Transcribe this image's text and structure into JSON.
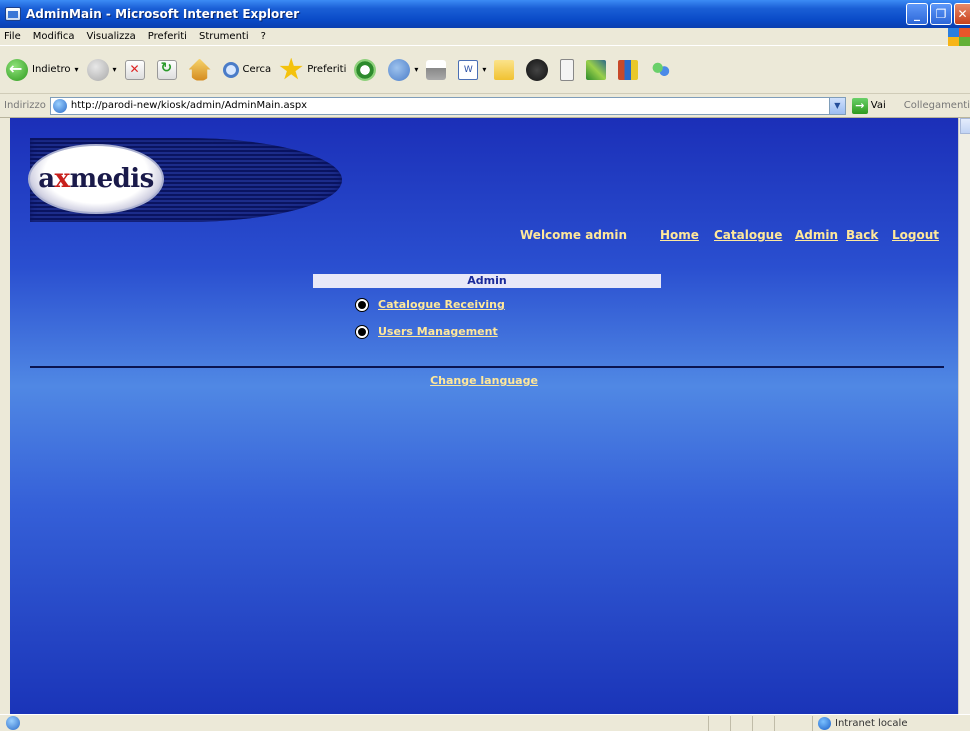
{
  "window": {
    "title": "AdminMain - Microsoft Internet Explorer",
    "buttons": [
      "_",
      "❐",
      "✕"
    ]
  },
  "menu": [
    "File",
    "Modifica",
    "Visualizza",
    "Preferiti",
    "Strumenti",
    "?"
  ],
  "toolbar": {
    "back_label": "Indietro",
    "search_label": "Cerca",
    "favorites_label": "Preferiti"
  },
  "address": {
    "label": "Indirizzo",
    "url": "http://parodi-new/kiosk/admin/AdminMain.aspx",
    "go_label": "Vai",
    "links_label": "Collegamenti"
  },
  "page": {
    "logo": {
      "pre": "a",
      "x": "x",
      "post": "medis"
    },
    "welcome": "Welcome admin",
    "nav": [
      "Home",
      "Catalogue",
      "Admin",
      "Back",
      "Logout"
    ],
    "admin_header": "Admin",
    "admin_items": [
      "Catalogue Receiving",
      "Users Management"
    ],
    "change_language": "Change language"
  },
  "status": {
    "zone": "Intranet locale"
  },
  "colors": {
    "link": "#ffe89a",
    "background_top": "#1b2fb8",
    "background_mid": "#5088e4"
  }
}
